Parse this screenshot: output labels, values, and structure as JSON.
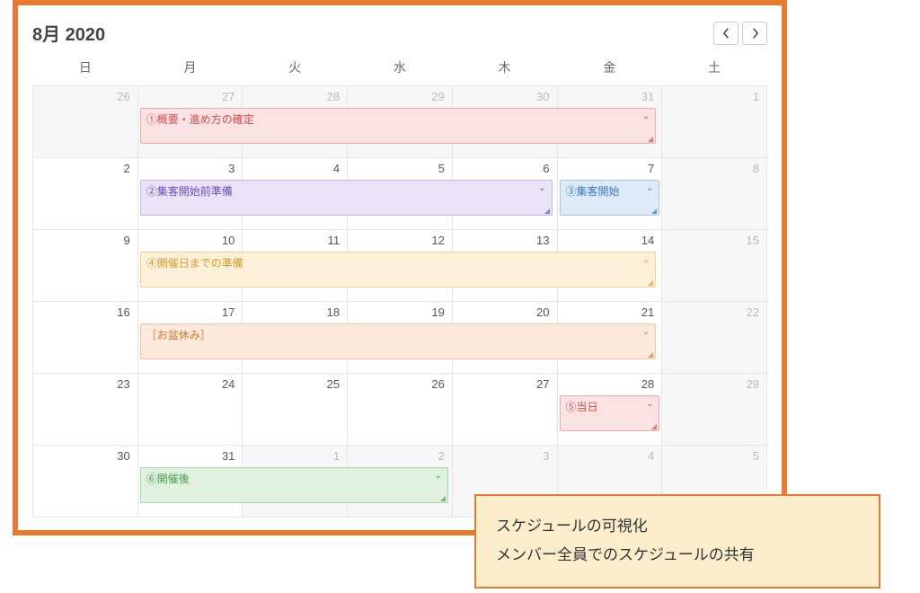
{
  "header": {
    "title": "8月 2020"
  },
  "weekdays": [
    "日",
    "月",
    "火",
    "水",
    "木",
    "金",
    "土"
  ],
  "weeks": [
    {
      "days": [
        {
          "num": "26",
          "dim": true
        },
        {
          "num": "27",
          "dim": true
        },
        {
          "num": "28",
          "dim": true
        },
        {
          "num": "29",
          "dim": true
        },
        {
          "num": "30",
          "dim": true
        },
        {
          "num": "31",
          "dim": true
        },
        {
          "num": "1",
          "dim": true
        }
      ],
      "events": [
        {
          "label": "①概要・進め方の確定",
          "startCol": 1,
          "span": 5,
          "color": "red"
        }
      ]
    },
    {
      "days": [
        {
          "num": "2"
        },
        {
          "num": "3"
        },
        {
          "num": "4"
        },
        {
          "num": "5"
        },
        {
          "num": "6"
        },
        {
          "num": "7"
        },
        {
          "num": "8",
          "dim": true
        }
      ],
      "events": [
        {
          "label": "②集客開始前準備",
          "startCol": 1,
          "span": 4,
          "color": "purple"
        },
        {
          "label": "③集客開始",
          "startCol": 5,
          "span": 1,
          "color": "blue"
        }
      ]
    },
    {
      "days": [
        {
          "num": "9"
        },
        {
          "num": "10"
        },
        {
          "num": "11"
        },
        {
          "num": "12"
        },
        {
          "num": "13"
        },
        {
          "num": "14"
        },
        {
          "num": "15",
          "dim": true
        }
      ],
      "events": [
        {
          "label": "④開催日までの準備",
          "startCol": 1,
          "span": 5,
          "color": "amber"
        }
      ]
    },
    {
      "days": [
        {
          "num": "16"
        },
        {
          "num": "17"
        },
        {
          "num": "18"
        },
        {
          "num": "19"
        },
        {
          "num": "20"
        },
        {
          "num": "21"
        },
        {
          "num": "22",
          "dim": true
        }
      ],
      "events": [
        {
          "label": "［お盆休み］",
          "startCol": 1,
          "span": 5,
          "color": "orange"
        }
      ]
    },
    {
      "days": [
        {
          "num": "23"
        },
        {
          "num": "24"
        },
        {
          "num": "25"
        },
        {
          "num": "26"
        },
        {
          "num": "27"
        },
        {
          "num": "28"
        },
        {
          "num": "29",
          "dim": true
        }
      ],
      "events": [
        {
          "label": "⑤当日",
          "startCol": 5,
          "span": 1,
          "color": "red2"
        }
      ]
    },
    {
      "days": [
        {
          "num": "30"
        },
        {
          "num": "31"
        },
        {
          "num": "1",
          "dim": true
        },
        {
          "num": "2",
          "dim": true
        },
        {
          "num": "3",
          "dim": true
        },
        {
          "num": "4",
          "dim": true
        },
        {
          "num": "5",
          "dim": true
        }
      ],
      "events": [
        {
          "label": "⑥開催後",
          "startCol": 1,
          "span": 3,
          "color": "green"
        }
      ]
    }
  ],
  "colors": {
    "red": "ev-red",
    "purple": "ev-purple",
    "blue": "ev-blue",
    "amber": "ev-amber",
    "orange": "ev-orange",
    "red2": "ev-red2",
    "green": "ev-green"
  },
  "callout": {
    "line1": "スケジュールの可視化",
    "line2": "メンバー全員でのスケジュールの共有"
  }
}
